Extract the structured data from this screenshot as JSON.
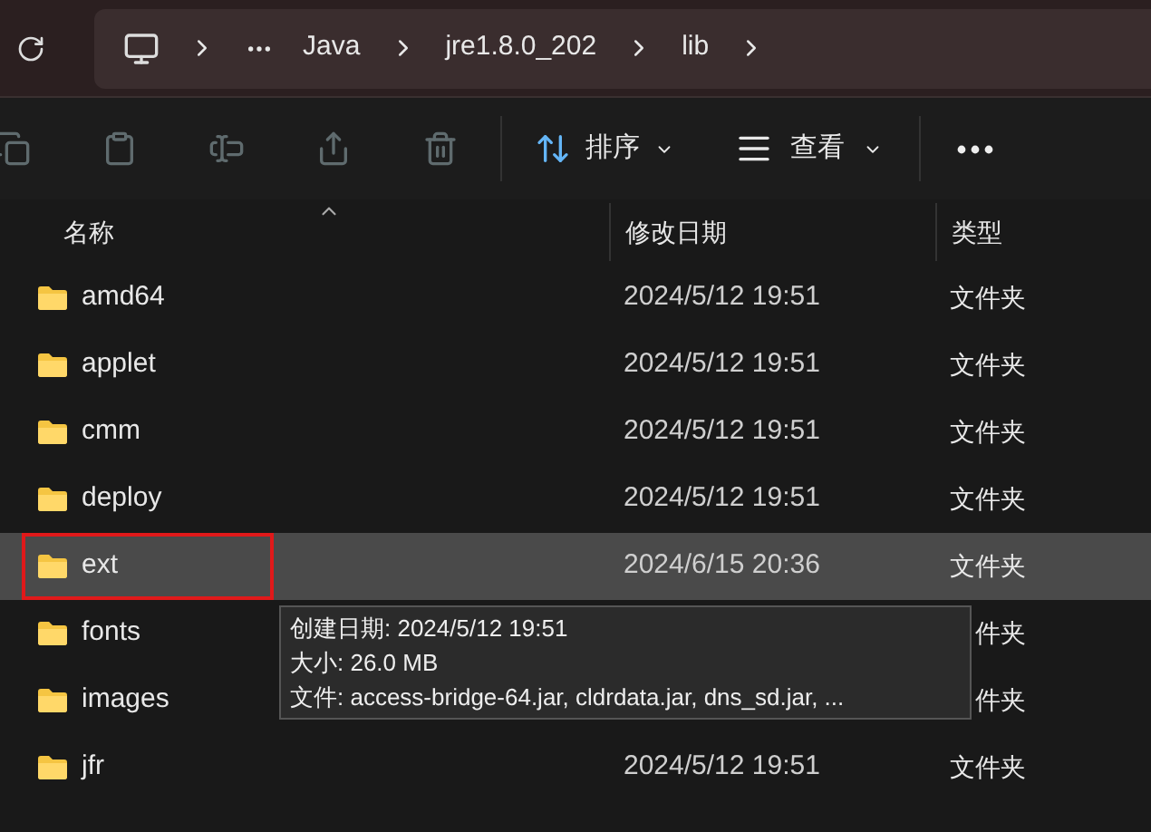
{
  "address_bar": {
    "crumbs": [
      "Java",
      "jre1.8.0_202",
      "lib"
    ]
  },
  "toolbar": {
    "actions": [
      {
        "kind": "copy",
        "disabled": true
      },
      {
        "kind": "paste",
        "disabled": true
      },
      {
        "kind": "rename",
        "disabled": true
      },
      {
        "kind": "share",
        "disabled": true
      },
      {
        "kind": "delete",
        "disabled": true
      }
    ],
    "sort": "排序",
    "view": "查看"
  },
  "columns": [
    "名称",
    "修改日期",
    "类型"
  ],
  "rows": [
    {
      "name": "amd64",
      "date": "2024/5/12 19:51",
      "type": "文件夹",
      "selected": false
    },
    {
      "name": "applet",
      "date": "2024/5/12 19:51",
      "type": "文件夹",
      "selected": false
    },
    {
      "name": "cmm",
      "date": "2024/5/12 19:51",
      "type": "文件夹",
      "selected": false
    },
    {
      "name": "deploy",
      "date": "2024/5/12 19:51",
      "type": "文件夹",
      "selected": false
    },
    {
      "name": "ext",
      "date": "2024/6/15 20:36",
      "type": "文件夹",
      "selected": true
    },
    {
      "name": "fonts",
      "type": "件夹",
      "selected": false
    },
    {
      "name": "images",
      "type": "件夹",
      "selected": false
    },
    {
      "name": "jfr",
      "date": "2024/5/12 19:51",
      "type": "文件夹",
      "selected": false
    }
  ],
  "tooltip": {
    "lines": [
      "创建日期: 2024/5/12 19:51",
      "大小: 26.0 MB",
      "文件: access-bridge-64.jar, cldrdata.jar, dns_sd.jar, ..."
    ]
  }
}
